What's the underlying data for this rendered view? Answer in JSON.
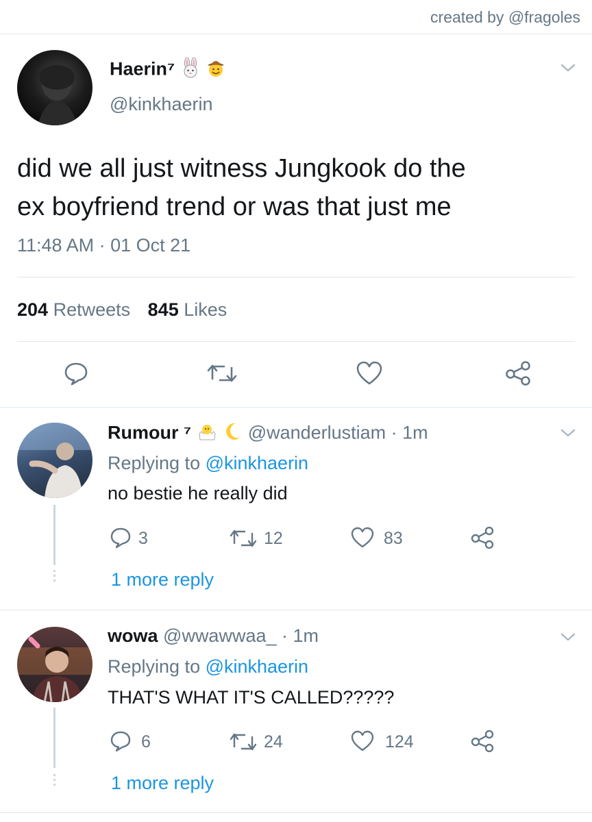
{
  "watermark": "created by @fragoles",
  "main_tweet": {
    "display_name": "Haerin⁷",
    "handle": "@kinkhaerin",
    "text_line1": "did we all just witness Jungkook do the",
    "text_line2": "ex boyfriend trend or was that just me",
    "timestamp": "11:48 AM · 01 Oct 21",
    "retweets_count": "204",
    "retweets_label": "Retweets",
    "likes_count": "845",
    "likes_label": "Likes"
  },
  "replies": [
    {
      "display_name": "Rumour ⁷",
      "handle_time": "@wanderlustiam · 1m",
      "replying_prefix": "Replying to ",
      "replying_handle": "@kinkhaerin",
      "text": "no bestie he really did",
      "reply_count": "3",
      "retweet_count": "12",
      "like_count": "83",
      "more_replies": "1 more reply"
    },
    {
      "display_name": "wowa",
      "handle_time": "@wwawwaa_ · 1m",
      "replying_prefix": "Replying to ",
      "replying_handle": "@kinkhaerin",
      "text": "THAT'S WHAT IT'S CALLED?????",
      "reply_count": "6",
      "retweet_count": "24",
      "like_count": "124",
      "more_replies": "1 more reply"
    }
  ],
  "colors": {
    "text": "#14171a",
    "secondary": "#657786",
    "link": "#1b95e0",
    "divider": "#e1e8ed"
  },
  "icons": [
    "chevron-down-icon",
    "bunny-emoji-icon",
    "cowboy-emoji-icon",
    "chick-emoji-icon",
    "moon-emoji-icon",
    "reply-icon",
    "retweet-icon",
    "like-icon",
    "share-icon"
  ]
}
